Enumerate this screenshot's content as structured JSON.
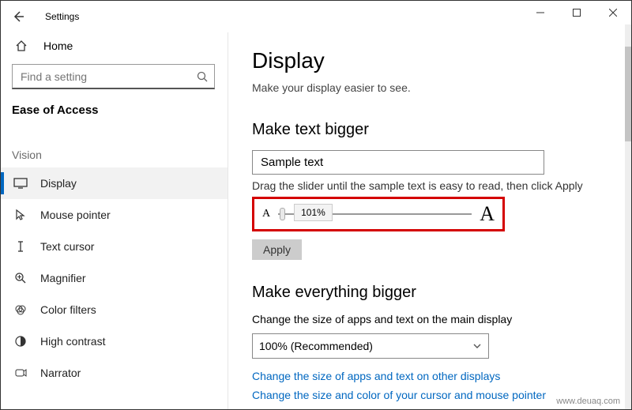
{
  "appTitle": "Settings",
  "sidebar": {
    "home": "Home",
    "searchPlaceholder": "Find a setting",
    "section": "Ease of Access",
    "groupLabel": "Vision",
    "items": [
      {
        "label": "Display"
      },
      {
        "label": "Mouse pointer"
      },
      {
        "label": "Text cursor"
      },
      {
        "label": "Magnifier"
      },
      {
        "label": "Color filters"
      },
      {
        "label": "High contrast"
      },
      {
        "label": "Narrator"
      }
    ]
  },
  "main": {
    "title": "Display",
    "subtitle": "Make your display easier to see.",
    "textBigger": {
      "heading": "Make text bigger",
      "sample": "Sample text",
      "hint": "Drag the slider until the sample text is easy to read, then click Apply",
      "sliderReadout": "101%",
      "smallA": "A",
      "bigA": "A",
      "applyLabel": "Apply"
    },
    "everythingBigger": {
      "heading": "Make everything bigger",
      "desc": "Change the size of apps and text on the main display",
      "comboValue": "100% (Recommended)",
      "link1": "Change the size of apps and text on other displays",
      "link2": "Change the size and color of your cursor and mouse pointer"
    }
  },
  "credit": "www.deuaq.com"
}
